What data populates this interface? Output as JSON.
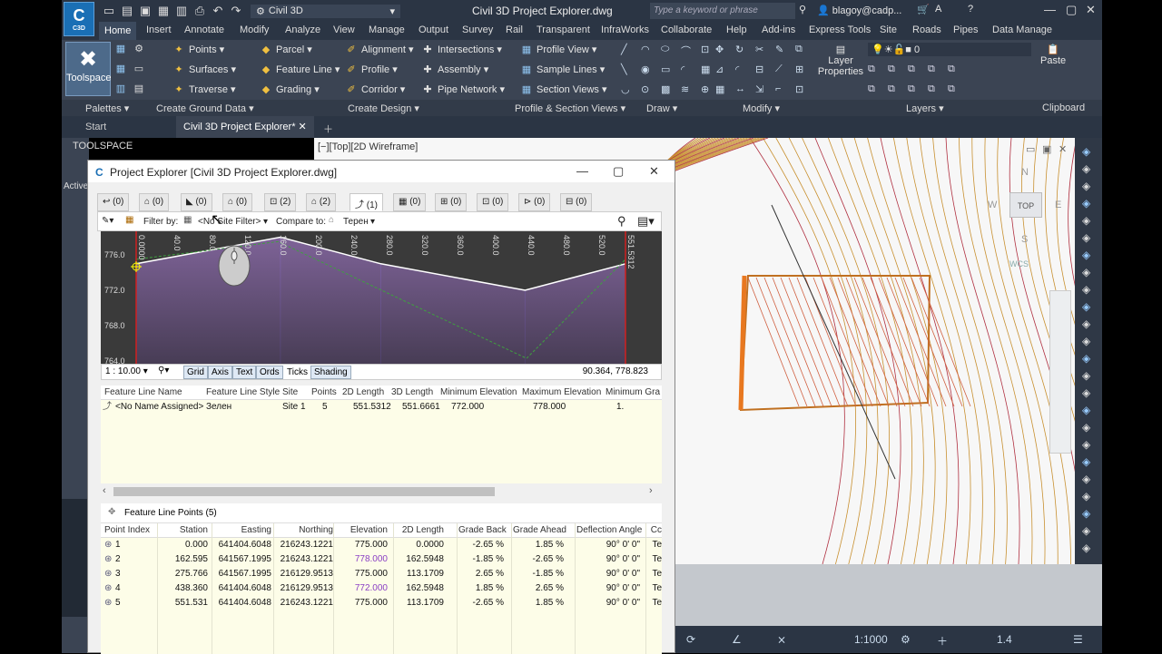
{
  "app": {
    "logo_text": "C",
    "logo_sub": "C3D",
    "workspace": "Civil 3D",
    "doc_title": "Civil 3D Project Explorer.dwg",
    "search_placeholder": "Type a keyword or phrase",
    "user": "blagoy@cadp..."
  },
  "ribbon_tabs": [
    "Home",
    "Insert",
    "Annotate",
    "Modify",
    "Analyze",
    "View",
    "Manage",
    "Output",
    "Survey",
    "Rail",
    "Transparent",
    "InfraWorks",
    "Collaborate",
    "Help",
    "Add-ins",
    "Express Tools",
    "Site",
    "Roads",
    "Pipes",
    "Data Manage"
  ],
  "ribbon": {
    "toolspace_label": "Toolspace",
    "ground": [
      "Points",
      "Surfaces",
      "Traverse"
    ],
    "design_col1": [
      "Parcel",
      "Feature Line",
      "Grading"
    ],
    "design_col2": [
      "Alignment",
      "Profile",
      "Corridor"
    ],
    "design_col3": [
      "Intersections",
      "Assembly",
      "Pipe Network"
    ],
    "profile_col": [
      "Profile View",
      "Sample Lines",
      "Section Views"
    ],
    "layer_props": "Layer Properties",
    "layer_value": "0",
    "paste": "Paste",
    "groups": [
      "Palettes",
      "Create Ground Data",
      "Create Design",
      "Profile & Section Views",
      "Draw",
      "Modify",
      "Layers",
      "Clipboard"
    ]
  },
  "doctabs": {
    "start": "Start",
    "active": "Civil 3D Project Explorer*"
  },
  "toolspace": {
    "title": "TOOLSPACE",
    "active": "Active"
  },
  "canvas": {
    "label": "[−][Top][2D Wireframe]",
    "top": "TOP",
    "n": "N",
    "s": "S",
    "w": "W",
    "e": "E",
    "wcs": "WCS"
  },
  "statusbar": {
    "scale": "1:1000",
    "lw": "1.4"
  },
  "dialog": {
    "title": "Project Explorer [Civil 3D Project Explorer.dwg]",
    "tabs": [
      "(0)",
      "(0)",
      "(0)",
      "(0)",
      "(2)",
      "(2)",
      "(1)",
      "(0)",
      "(0)",
      "(0)",
      "(0)",
      "(0)"
    ],
    "filter_by": "Filter by:",
    "filter_value": "<No Site Filter>",
    "compare_to": "Compare to:",
    "compare_value": "Терен",
    "profile": {
      "x_ticks": [
        "0.0000",
        "40.0",
        "80.0",
        "120.0",
        "160.0",
        "200.0",
        "240.0",
        "280.0",
        "320.0",
        "360.0",
        "400.0",
        "440.0",
        "480.0",
        "520.0",
        "551.5312"
      ],
      "y_ticks": [
        "776.0",
        "772.0",
        "768.0",
        "764.0"
      ]
    },
    "pv_toolbar": {
      "scale": "1 : 10.00",
      "buttons": [
        "Grid",
        "Axis",
        "Text",
        "Ords",
        "Ticks",
        "Shading"
      ],
      "coords": "90.364, 778.823"
    },
    "fl_headers": [
      "Feature Line Name",
      "Feature Line Style",
      "Site",
      "Points",
      "2D Length",
      "3D Length",
      "Minimum Elevation",
      "Maximum Elevation",
      "Minimum Gra"
    ],
    "fl_row": [
      "<No Name Assigned>",
      "Зелен",
      "Site 1",
      "5",
      "551.5312",
      "551.6661",
      "772.000",
      "778.000",
      "1."
    ],
    "pts_panel": "Feature Line Points (5)",
    "pts_headers": [
      "Point Index",
      "Station",
      "Easting",
      "Northing",
      "Elevation",
      "2D Length",
      "Grade Back",
      "Grade Ahead",
      "Deflection Angle",
      "Cc"
    ],
    "pts_rows": [
      [
        "1",
        "0.000",
        "641404.6048",
        "216243.1221",
        "775.000",
        "0.0000",
        "-2.65 %",
        "1.85 %",
        "90° 0' 0\"",
        "Te"
      ],
      [
        "2",
        "162.595",
        "641567.1995",
        "216243.1221",
        "778.000",
        "162.5948",
        "-1.85 %",
        "-2.65 %",
        "90° 0' 0\"",
        "Te"
      ],
      [
        "3",
        "275.766",
        "641567.1995",
        "216129.9513",
        "775.000",
        "113.1709",
        "2.65 %",
        "-1.85 %",
        "90° 0' 0\"",
        "Te"
      ],
      [
        "4",
        "438.360",
        "641404.6048",
        "216129.9513",
        "772.000",
        "162.5948",
        "1.85 %",
        "2.65 %",
        "90° 0' 0\"",
        "Te"
      ],
      [
        "5",
        "551.531",
        "641404.6048",
        "216243.1221",
        "775.000",
        "113.1709",
        "-2.65 %",
        "1.85 %",
        "90° 0' 0\"",
        "Te"
      ]
    ]
  }
}
